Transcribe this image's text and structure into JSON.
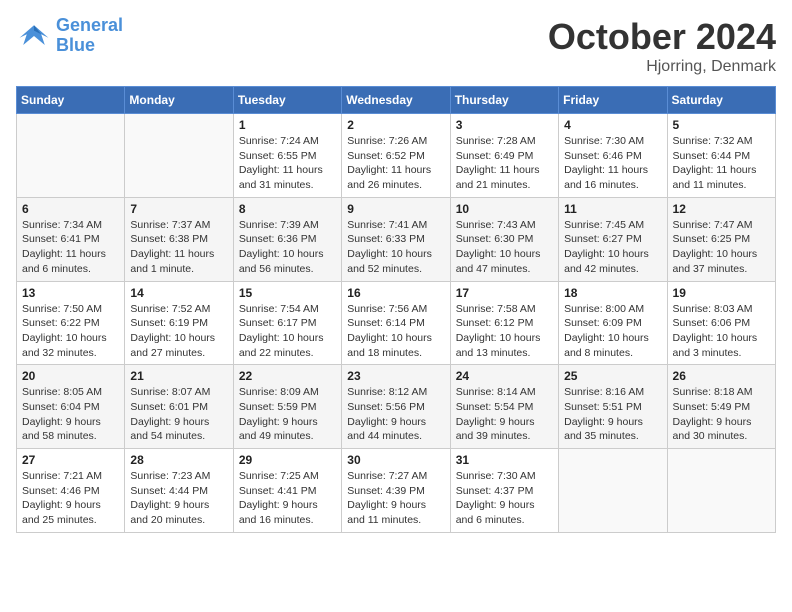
{
  "header": {
    "logo_line1": "General",
    "logo_line2": "Blue",
    "month_title": "October 2024",
    "location": "Hjorring, Denmark"
  },
  "weekdays": [
    "Sunday",
    "Monday",
    "Tuesday",
    "Wednesday",
    "Thursday",
    "Friday",
    "Saturday"
  ],
  "weeks": [
    [
      {
        "day": "",
        "info": ""
      },
      {
        "day": "",
        "info": ""
      },
      {
        "day": "1",
        "info": "Sunrise: 7:24 AM\nSunset: 6:55 PM\nDaylight: 11 hours\nand 31 minutes."
      },
      {
        "day": "2",
        "info": "Sunrise: 7:26 AM\nSunset: 6:52 PM\nDaylight: 11 hours\nand 26 minutes."
      },
      {
        "day": "3",
        "info": "Sunrise: 7:28 AM\nSunset: 6:49 PM\nDaylight: 11 hours\nand 21 minutes."
      },
      {
        "day": "4",
        "info": "Sunrise: 7:30 AM\nSunset: 6:46 PM\nDaylight: 11 hours\nand 16 minutes."
      },
      {
        "day": "5",
        "info": "Sunrise: 7:32 AM\nSunset: 6:44 PM\nDaylight: 11 hours\nand 11 minutes."
      }
    ],
    [
      {
        "day": "6",
        "info": "Sunrise: 7:34 AM\nSunset: 6:41 PM\nDaylight: 11 hours\nand 6 minutes."
      },
      {
        "day": "7",
        "info": "Sunrise: 7:37 AM\nSunset: 6:38 PM\nDaylight: 11 hours\nand 1 minute."
      },
      {
        "day": "8",
        "info": "Sunrise: 7:39 AM\nSunset: 6:36 PM\nDaylight: 10 hours\nand 56 minutes."
      },
      {
        "day": "9",
        "info": "Sunrise: 7:41 AM\nSunset: 6:33 PM\nDaylight: 10 hours\nand 52 minutes."
      },
      {
        "day": "10",
        "info": "Sunrise: 7:43 AM\nSunset: 6:30 PM\nDaylight: 10 hours\nand 47 minutes."
      },
      {
        "day": "11",
        "info": "Sunrise: 7:45 AM\nSunset: 6:27 PM\nDaylight: 10 hours\nand 42 minutes."
      },
      {
        "day": "12",
        "info": "Sunrise: 7:47 AM\nSunset: 6:25 PM\nDaylight: 10 hours\nand 37 minutes."
      }
    ],
    [
      {
        "day": "13",
        "info": "Sunrise: 7:50 AM\nSunset: 6:22 PM\nDaylight: 10 hours\nand 32 minutes."
      },
      {
        "day": "14",
        "info": "Sunrise: 7:52 AM\nSunset: 6:19 PM\nDaylight: 10 hours\nand 27 minutes."
      },
      {
        "day": "15",
        "info": "Sunrise: 7:54 AM\nSunset: 6:17 PM\nDaylight: 10 hours\nand 22 minutes."
      },
      {
        "day": "16",
        "info": "Sunrise: 7:56 AM\nSunset: 6:14 PM\nDaylight: 10 hours\nand 18 minutes."
      },
      {
        "day": "17",
        "info": "Sunrise: 7:58 AM\nSunset: 6:12 PM\nDaylight: 10 hours\nand 13 minutes."
      },
      {
        "day": "18",
        "info": "Sunrise: 8:00 AM\nSunset: 6:09 PM\nDaylight: 10 hours\nand 8 minutes."
      },
      {
        "day": "19",
        "info": "Sunrise: 8:03 AM\nSunset: 6:06 PM\nDaylight: 10 hours\nand 3 minutes."
      }
    ],
    [
      {
        "day": "20",
        "info": "Sunrise: 8:05 AM\nSunset: 6:04 PM\nDaylight: 9 hours\nand 58 minutes."
      },
      {
        "day": "21",
        "info": "Sunrise: 8:07 AM\nSunset: 6:01 PM\nDaylight: 9 hours\nand 54 minutes."
      },
      {
        "day": "22",
        "info": "Sunrise: 8:09 AM\nSunset: 5:59 PM\nDaylight: 9 hours\nand 49 minutes."
      },
      {
        "day": "23",
        "info": "Sunrise: 8:12 AM\nSunset: 5:56 PM\nDaylight: 9 hours\nand 44 minutes."
      },
      {
        "day": "24",
        "info": "Sunrise: 8:14 AM\nSunset: 5:54 PM\nDaylight: 9 hours\nand 39 minutes."
      },
      {
        "day": "25",
        "info": "Sunrise: 8:16 AM\nSunset: 5:51 PM\nDaylight: 9 hours\nand 35 minutes."
      },
      {
        "day": "26",
        "info": "Sunrise: 8:18 AM\nSunset: 5:49 PM\nDaylight: 9 hours\nand 30 minutes."
      }
    ],
    [
      {
        "day": "27",
        "info": "Sunrise: 7:21 AM\nSunset: 4:46 PM\nDaylight: 9 hours\nand 25 minutes."
      },
      {
        "day": "28",
        "info": "Sunrise: 7:23 AM\nSunset: 4:44 PM\nDaylight: 9 hours\nand 20 minutes."
      },
      {
        "day": "29",
        "info": "Sunrise: 7:25 AM\nSunset: 4:41 PM\nDaylight: 9 hours\nand 16 minutes."
      },
      {
        "day": "30",
        "info": "Sunrise: 7:27 AM\nSunset: 4:39 PM\nDaylight: 9 hours\nand 11 minutes."
      },
      {
        "day": "31",
        "info": "Sunrise: 7:30 AM\nSunset: 4:37 PM\nDaylight: 9 hours\nand 6 minutes."
      },
      {
        "day": "",
        "info": ""
      },
      {
        "day": "",
        "info": ""
      }
    ]
  ]
}
